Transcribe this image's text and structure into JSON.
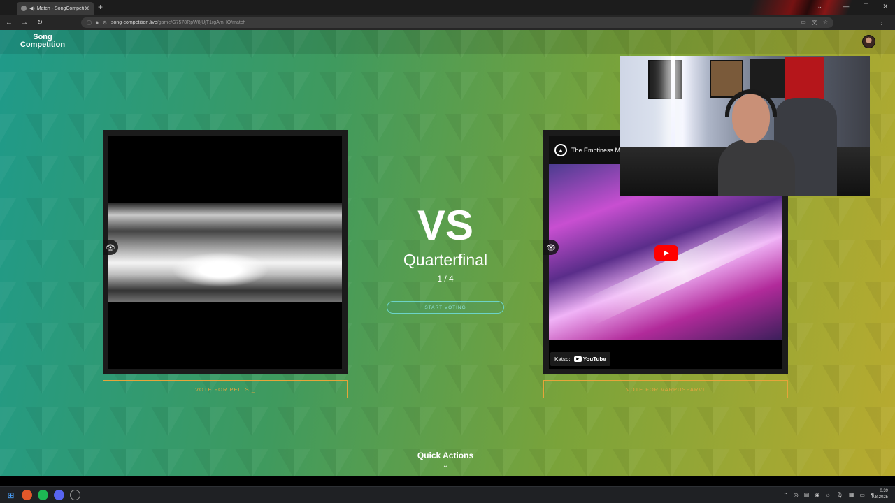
{
  "browser": {
    "tab_title": "Match - SongCompetition",
    "sound_icon": "◀)",
    "close_glyph": "✕",
    "newtab_glyph": "+",
    "url_host": "song-competition.live",
    "url_path": "/game/G7578RpW8jUjT1rgAmHO/match",
    "back_glyph": "←",
    "forward_glyph": "→",
    "reload_glyph": "↻",
    "menu_glyph": "⋮",
    "window_buttons": [
      "—",
      "☐",
      "✕"
    ]
  },
  "site": {
    "logo_line1": "Song",
    "logo_line2": "Competition"
  },
  "match": {
    "vs_label": "VS",
    "round": "Quarterfinal",
    "progress": "1 / 4",
    "start_label": "START VOTING",
    "vote_left": "VOTE FOR PELTSI_",
    "vote_right": "VOTE FOR VARPUSPARVI",
    "quick_actions": "Quick Actions"
  },
  "youtube": {
    "title": "The Emptiness M",
    "watch_on": "Katso:",
    "brand": "YouTube"
  },
  "clock": {
    "time": "0.39",
    "date": "9.8.2025"
  },
  "colors": {
    "vote_border": "#e6a53a",
    "start_border": "#6cd3c7",
    "youtube_red": "#ff0000"
  }
}
